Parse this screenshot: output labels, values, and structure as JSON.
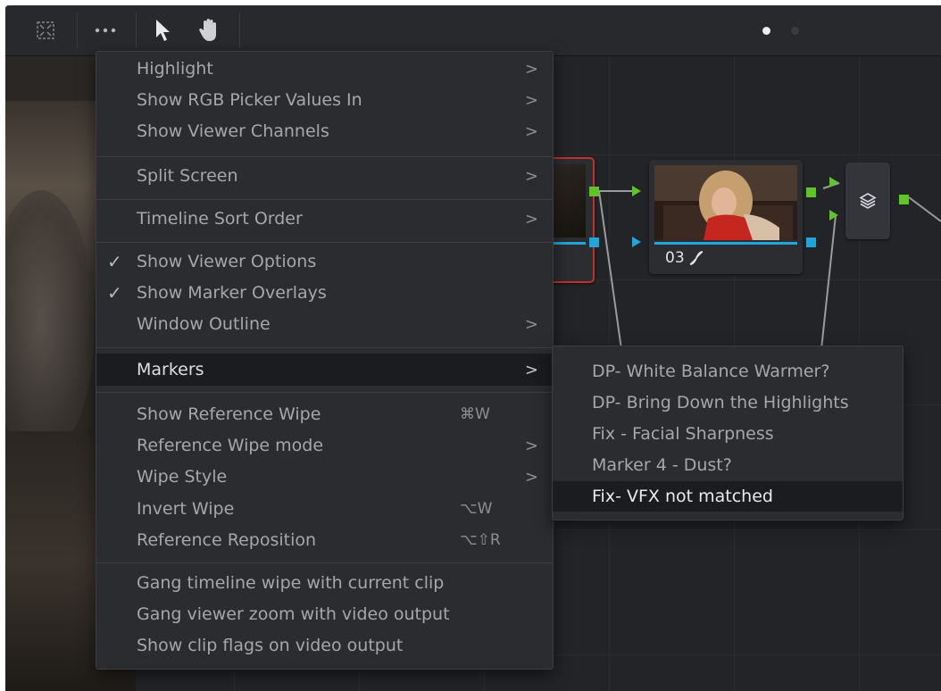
{
  "colors": {
    "accent_green": "#5fc425",
    "accent_blue": "#1fa6dd",
    "selected_node_outline": "#c0312b",
    "menu_bg": "#2b2c30",
    "menu_highlight": "#1b1c1f"
  },
  "toolbar": {
    "icons": [
      "fit-screen-icon",
      "more-options-icon",
      "pointer-icon",
      "hand-icon"
    ],
    "page_indicator": {
      "pages": 2,
      "active": 1
    }
  },
  "nodes": [
    {
      "id": "node-02",
      "label": "",
      "selected": true
    },
    {
      "id": "node-03",
      "label": "03",
      "has_curve_icon": true
    },
    {
      "id": "layer-mixer",
      "icon": "layers-icon"
    }
  ],
  "main_menu": {
    "items": [
      {
        "label": "Highlight",
        "has_submenu": true
      },
      {
        "label": "Show RGB Picker Values In",
        "has_submenu": true
      },
      {
        "label": "Show Viewer Channels",
        "has_submenu": true
      },
      {
        "label": "Split Screen",
        "has_submenu": true
      },
      {
        "label": "Timeline Sort Order",
        "has_submenu": true
      },
      {
        "label": "Show Viewer Options",
        "checked": true
      },
      {
        "label": "Show Marker Overlays",
        "checked": true
      },
      {
        "label": "Window Outline",
        "has_submenu": true
      },
      {
        "label": "Markers",
        "has_submenu": true,
        "active": true
      },
      {
        "label": "Show Reference Wipe",
        "shortcut": "⌘W"
      },
      {
        "label": "Reference Wipe mode",
        "has_submenu": true
      },
      {
        "label": "Wipe Style",
        "has_submenu": true
      },
      {
        "label": "Invert Wipe",
        "shortcut": "⌥W"
      },
      {
        "label": "Reference Reposition",
        "shortcut": "⌥⇧R"
      },
      {
        "label": "Gang timeline wipe with current clip"
      },
      {
        "label": "Gang viewer zoom with video output"
      },
      {
        "label": "Show clip flags on video output"
      }
    ],
    "check_glyph": "✓",
    "arrow_glyph": ">"
  },
  "markers_submenu": {
    "items": [
      {
        "label": "DP- White Balance Warmer?"
      },
      {
        "label": "DP- Bring Down the Highlights"
      },
      {
        "label": "Fix - Facial Sharpness"
      },
      {
        "label": "Marker 4 - Dust?"
      },
      {
        "label": "Fix- VFX not matched",
        "active": true
      }
    ]
  }
}
